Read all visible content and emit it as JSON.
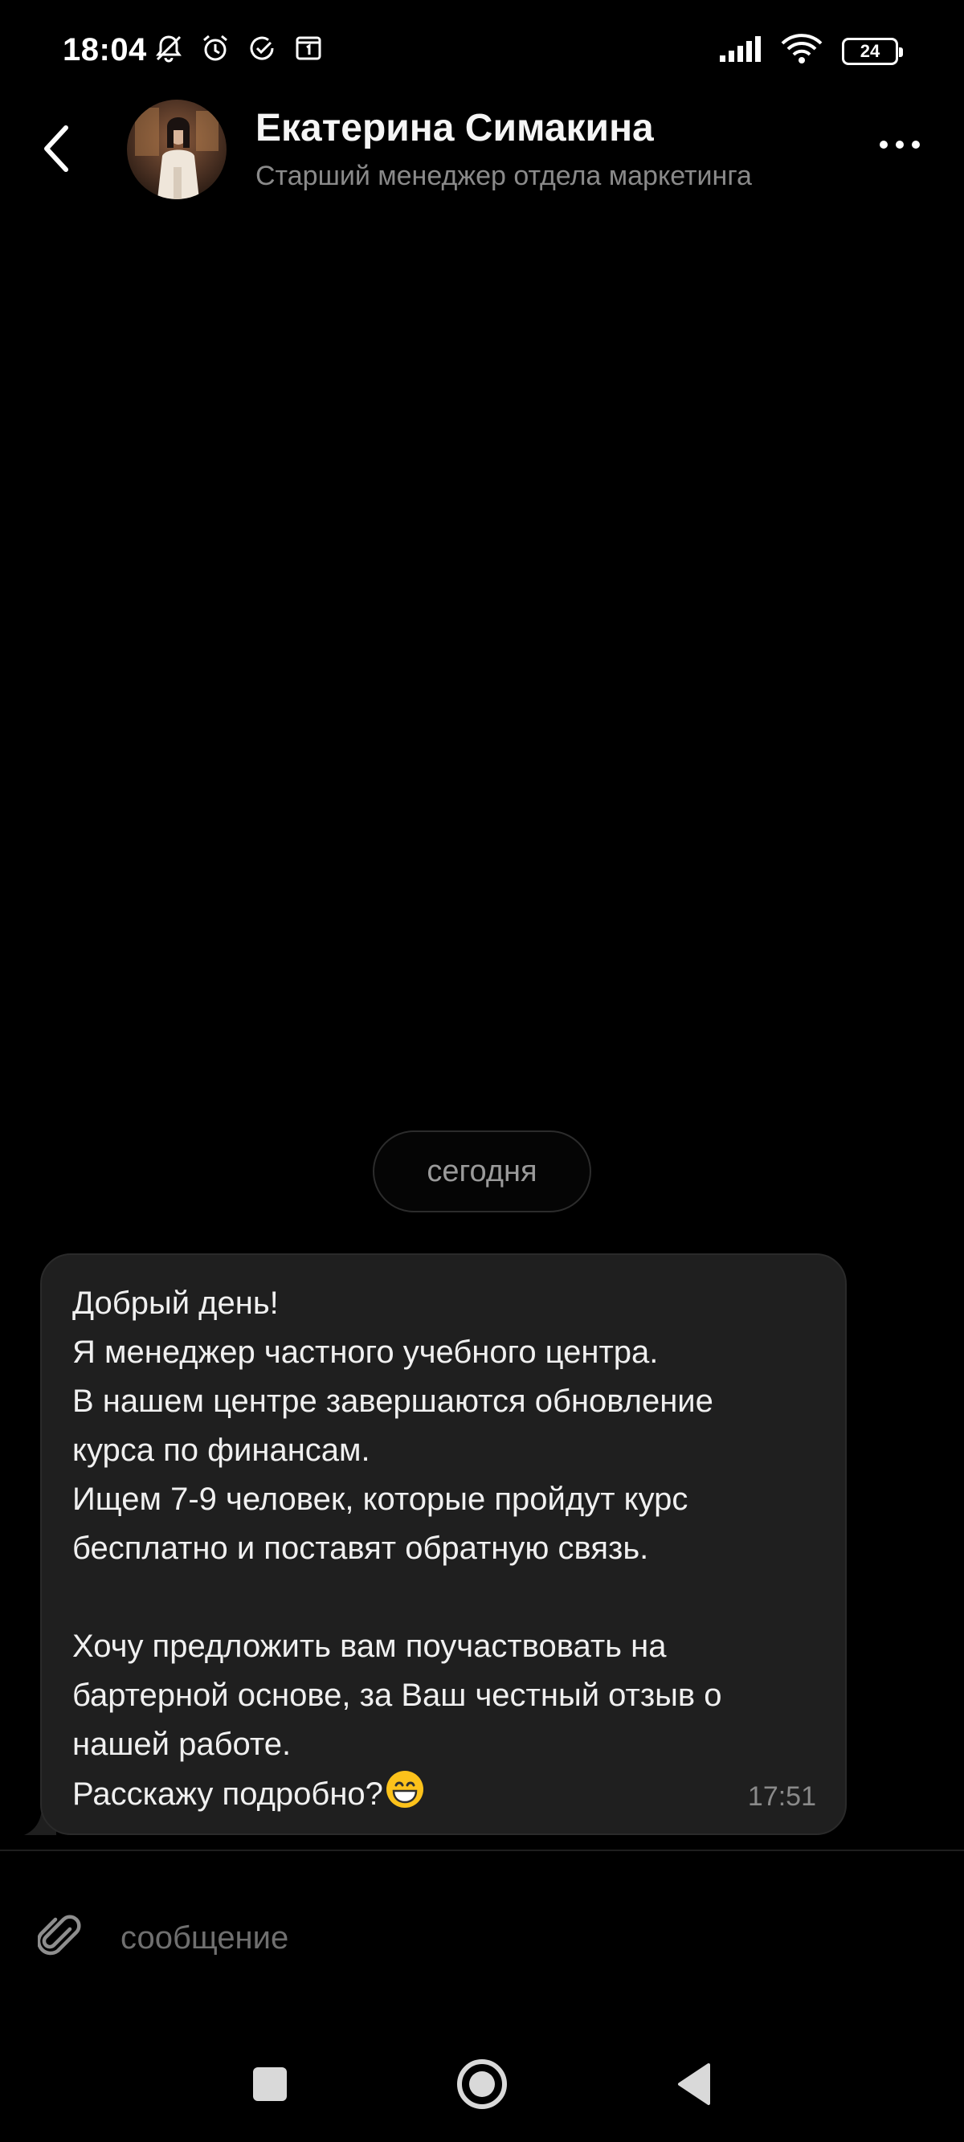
{
  "status_bar": {
    "time": "18:04",
    "battery_level": "24"
  },
  "header": {
    "contact_name": "Екатерина Симакина",
    "contact_title": "Старший менеджер отдела маркетинга"
  },
  "chat": {
    "date_label": "сегодня",
    "message": {
      "lines": [
        "Добрый день!",
        "Я менеджер частного учебного центра.",
        "В нашем центре завершаются обновление",
        "курса по финансам.",
        "Ищем 7-9 человек, которые пройдут курс",
        "бесплатно и поставят обратную связь.",
        "",
        "Хочу предложить вам поучаствовать на",
        "бартерной основе, за Ваш честный отзыв о",
        "нашей работе.",
        "Расскажу подробно?"
      ],
      "time": "17:51"
    }
  },
  "composer": {
    "placeholder": "сообщение"
  },
  "colors": {
    "background": "#000000",
    "bubble": "#1f1f1f",
    "secondary_text": "#8a8a8a"
  }
}
